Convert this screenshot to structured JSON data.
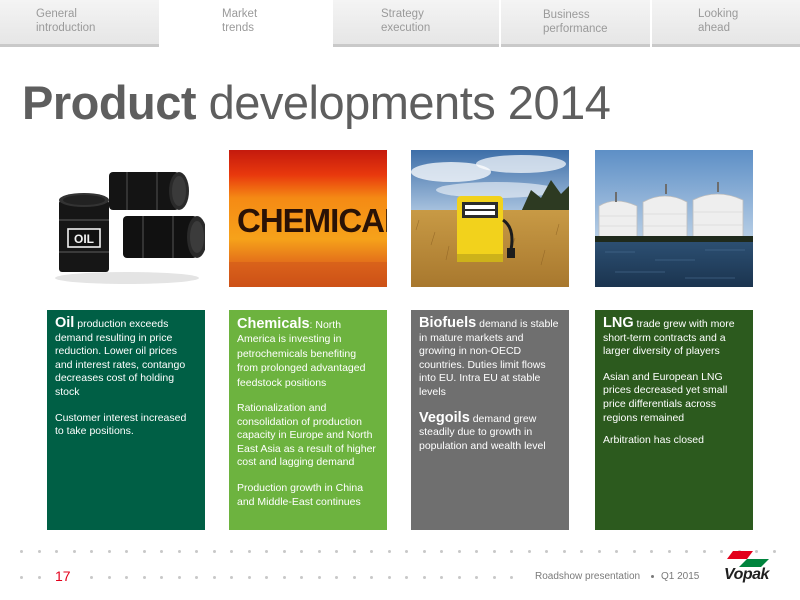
{
  "nav": {
    "tabs": [
      {
        "label": "General\nintroduction",
        "active": false
      },
      {
        "label": "Market\ntrends",
        "active": true
      },
      {
        "label": "Strategy\nexecution",
        "active": false
      },
      {
        "label": "Business\nperformance",
        "active": false
      },
      {
        "label": "Looking\nahead",
        "active": false
      }
    ]
  },
  "title": {
    "bold": "Product",
    "rest": " developments 2014"
  },
  "images": {
    "oil": {
      "barrel_label": "OIL"
    },
    "chemicals": {
      "sign_text": "CHEMICALS"
    }
  },
  "boxes": {
    "oil": {
      "head": "Oil",
      "text1": " production exceeds demand resulting in price reduction. Lower oil prices and interest rates, contango decreases cost of holding stock",
      "text2": "Customer interest increased to take positions."
    },
    "chemicals": {
      "head": "Chemicals",
      "text1": ": North America is investing in petrochemicals benefiting from prolonged advantaged feedstock positions",
      "text2": "Rationalization and consolidation of production capacity in Europe and North East Asia as a result of higher cost and lagging demand",
      "text3": "Production growth in China and Middle-East continues"
    },
    "biofuels": {
      "head": "Biofuels",
      "text1": " demand is stable in mature markets and growing in non-OECD countries. Duties limit flows into EU. Intra EU at stable levels",
      "head2": "Vegoils",
      "text2": " demand grew steadily due to growth in population and wealth level"
    },
    "lng": {
      "head": "LNG",
      "text1": " trade grew with more short-term contracts and a larger diversity of players",
      "text2": "Asian and European LNG prices decreased yet small price differentials across regions remained",
      "text3": "Arbitration has closed"
    }
  },
  "footer": {
    "page_number": "17",
    "presentation": "Roadshow presentation",
    "period": "Q1 2015",
    "logo_text": "Vopak"
  },
  "colors": {
    "oil_box": "#005f45",
    "chemicals_box": "#6db33f",
    "biofuels_box": "#6f6f6f",
    "lng_box": "#2c5a1e",
    "accent_red": "#e3001b"
  }
}
